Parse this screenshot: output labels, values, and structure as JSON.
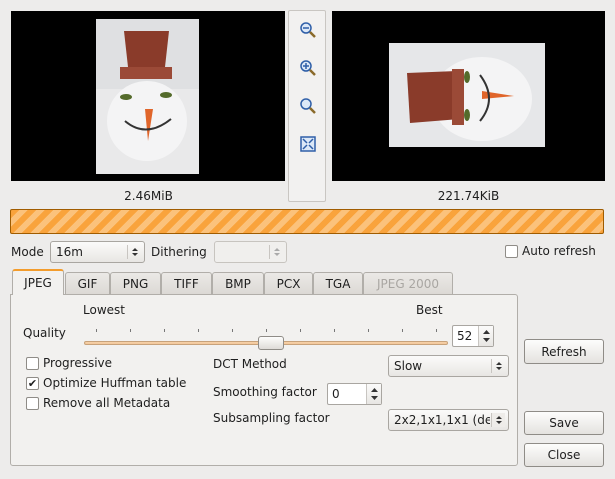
{
  "previews": {
    "original_size": "2.46MiB",
    "converted_size": "221.74KiB"
  },
  "zoom_toolbar": {
    "icons": [
      "zoom-out-icon",
      "zoom-in-icon",
      "zoom-original-icon",
      "zoom-fit-icon"
    ]
  },
  "options": {
    "mode_label": "Mode",
    "mode_value": "16m",
    "dithering_label": "Dithering",
    "dithering_value": "",
    "auto_refresh_label": "Auto refresh",
    "auto_refresh_checked": false
  },
  "tabs": [
    {
      "label": "JPEG",
      "active": true,
      "enabled": true
    },
    {
      "label": "GIF",
      "active": false,
      "enabled": true
    },
    {
      "label": "PNG",
      "active": false,
      "enabled": true
    },
    {
      "label": "TIFF",
      "active": false,
      "enabled": true
    },
    {
      "label": "BMP",
      "active": false,
      "enabled": true
    },
    {
      "label": "PCX",
      "active": false,
      "enabled": true
    },
    {
      "label": "TGA",
      "active": false,
      "enabled": true
    },
    {
      "label": "JPEG 2000",
      "active": false,
      "enabled": false
    }
  ],
  "jpeg": {
    "lowest_label": "Lowest",
    "best_label": "Best",
    "quality_label": "Quality",
    "quality_value": "52",
    "quality_fraction": 0.52,
    "progressive_label": "Progressive",
    "progressive_checked": false,
    "huffman_label": "Optimize Huffman table",
    "huffman_checked": true,
    "metadata_label": "Remove all Metadata",
    "metadata_checked": false,
    "dct_label": "DCT Method",
    "dct_value": "Slow",
    "smoothing_label": "Smoothing factor",
    "smoothing_value": "0",
    "subsampling_label": "Subsampling factor",
    "subsampling_value": "2x2,1x1,1x1 (de"
  },
  "buttons": {
    "refresh": "Refresh",
    "save": "Save",
    "close": "Close"
  },
  "colors": {
    "accent": "#f39c2c",
    "progress_stripe_a": "#f9a33c",
    "progress_stripe_b": "#fbc27c"
  }
}
